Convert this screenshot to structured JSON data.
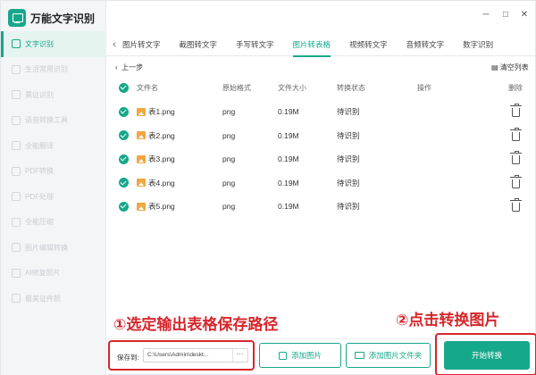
{
  "app": {
    "title": "万能文字识别",
    "accent": "#16a88a",
    "annotation_color": "#d6262b"
  },
  "window_controls": [
    "─",
    "□",
    "✕"
  ],
  "sidebar": {
    "items": [
      {
        "label": "文字识别",
        "active": true
      },
      {
        "label": "生活常用识别"
      },
      {
        "label": "票证识别"
      },
      {
        "label": "语音转换工具"
      },
      {
        "label": "全能翻译"
      },
      {
        "label": "PDF转换"
      },
      {
        "label": "PDF处理"
      },
      {
        "label": "全能压缩"
      },
      {
        "label": "图片编辑转换"
      },
      {
        "label": "AI修复照片"
      },
      {
        "label": "最美证件照"
      }
    ]
  },
  "tabs": {
    "prev_icon": "‹",
    "items": [
      {
        "label": "图片转文字"
      },
      {
        "label": "截图转文字"
      },
      {
        "label": "手写转文字"
      },
      {
        "label": "图片转表格",
        "active": true
      },
      {
        "label": "视频转文字"
      },
      {
        "label": "音频转文字"
      },
      {
        "label": "数字识别"
      }
    ]
  },
  "toolbar": {
    "back_label": "上一步",
    "clear_label": "清空列表"
  },
  "table": {
    "headers": {
      "name": "文件名",
      "format": "原始格式",
      "size": "文件大小",
      "status": "转换状态",
      "action": "操作",
      "delete": "删除"
    },
    "rows": [
      {
        "name": "表1.png",
        "format": "png",
        "size": "0.19M",
        "status": "待识别"
      },
      {
        "name": "表2.png",
        "format": "png",
        "size": "0.19M",
        "status": "待识别"
      },
      {
        "name": "表3.png",
        "format": "png",
        "size": "0.19M",
        "status": "待识别"
      },
      {
        "name": "表4.png",
        "format": "png",
        "size": "0.19M",
        "status": "待识别"
      },
      {
        "name": "表5.png",
        "format": "png",
        "size": "0.19M",
        "status": "待识别"
      }
    ]
  },
  "annotations": {
    "step1": "①选定输出表格保存路径",
    "step2": "②点击转换图片"
  },
  "footer": {
    "save_label": "保存到:",
    "save_path": "C:\\Users\\Admin\\deskt...",
    "more_label": "···",
    "add_image_label": "添加图片",
    "add_folder_label": "添加图片文件夹",
    "start_label": "开始转换"
  }
}
